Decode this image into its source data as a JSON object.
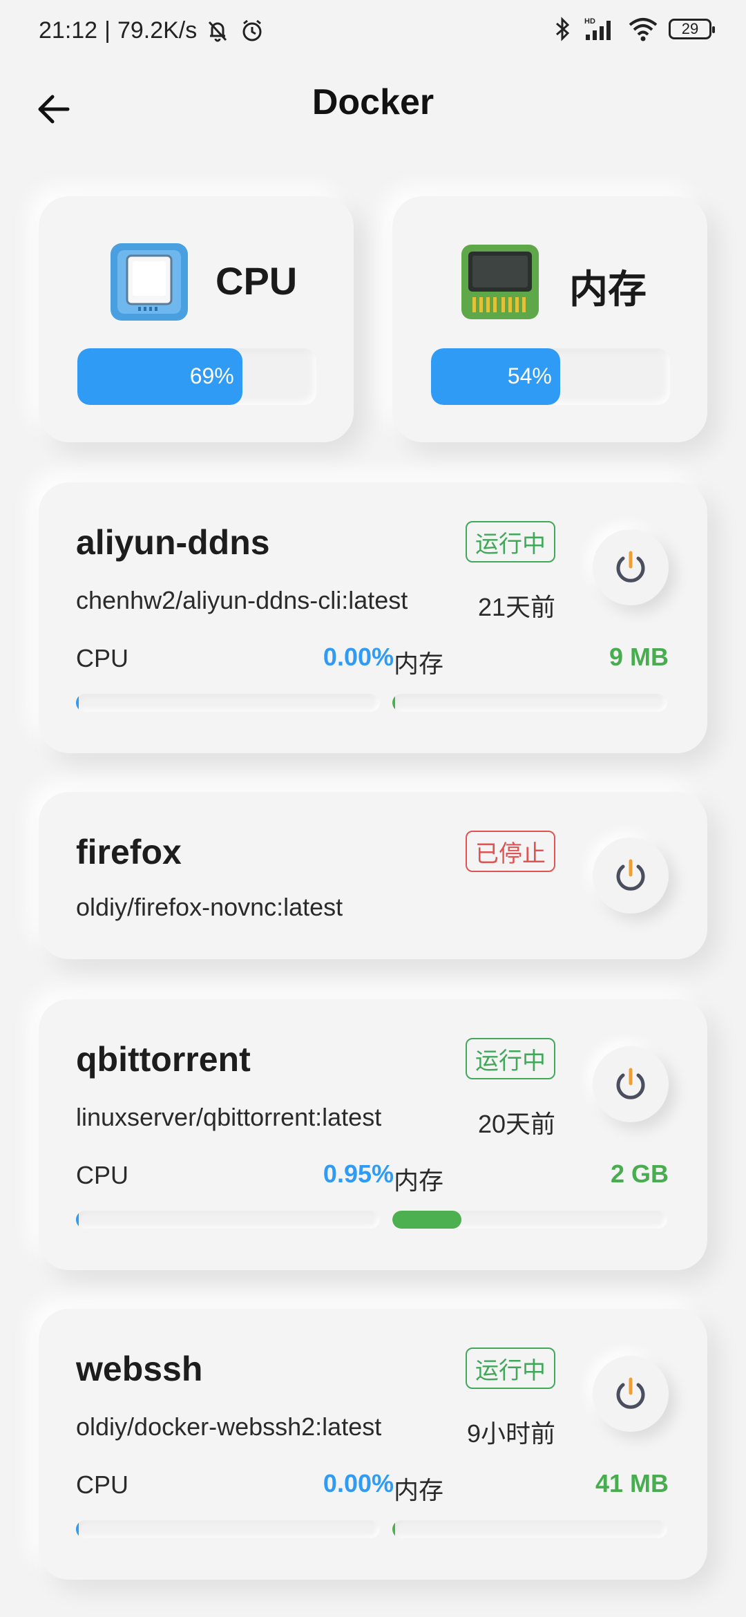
{
  "status": {
    "time": "21:12",
    "separator": "|",
    "speed": "79.2K/s",
    "battery": "29",
    "network": "HD"
  },
  "header": {
    "title": "Docker"
  },
  "summary": {
    "cpu": {
      "label": "CPU",
      "percent_text": "69%",
      "percent": 69
    },
    "mem": {
      "label": "内存",
      "percent_text": "54%",
      "percent": 54
    }
  },
  "labels": {
    "cpu": "CPU",
    "mem": "内存"
  },
  "colors": {
    "accent_blue": "#2f9bf4",
    "green": "#48ad4f",
    "red": "#e05353"
  },
  "containers": [
    {
      "name": "aliyun-ddns",
      "status": "运行中",
      "status_kind": "running",
      "image": "chenhw2/aliyun-ddns-cli:latest",
      "time": "21天前",
      "cpu": "0.00%",
      "cpu_fraction": 0.0,
      "mem": "9 MB",
      "mem_fraction": 0.005
    },
    {
      "name": "firefox",
      "status": "已停止",
      "status_kind": "stopped",
      "image": "oldiy/firefox-novnc:latest"
    },
    {
      "name": "qbittorrent",
      "status": "运行中",
      "status_kind": "running",
      "image": "linuxserver/qbittorrent:latest",
      "time": "20天前",
      "cpu": "0.95%",
      "cpu_fraction": 0.0095,
      "mem": "2 GB",
      "mem_fraction": 0.25
    },
    {
      "name": "webssh",
      "status": "运行中",
      "status_kind": "running",
      "image": "oldiy/docker-webssh2:latest",
      "time": "9小时前",
      "cpu": "0.00%",
      "cpu_fraction": 0.0,
      "mem": "41 MB",
      "mem_fraction": 0.005
    }
  ]
}
